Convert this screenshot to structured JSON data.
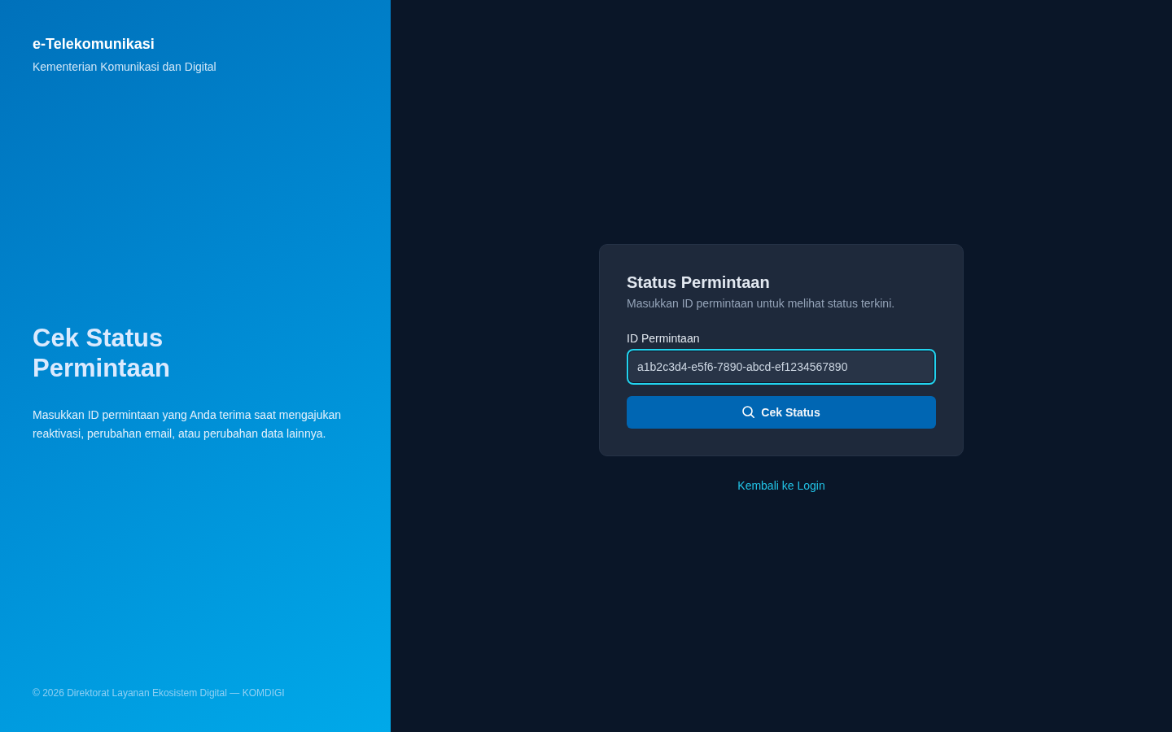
{
  "brand": {
    "title": "e-Telekomunikasi",
    "subtitle": "Kementerian Komunikasi dan Digital"
  },
  "hero": {
    "title": "Cek Status Permintaan",
    "description": "Masukkan ID permintaan yang Anda terima saat mengajukan reaktivasi, perubahan email, atau perubahan data lainnya."
  },
  "footer": "© 2026 Direktorat Layanan Ekosistem Digital — KOMDIGI",
  "card": {
    "title": "Status Permintaan",
    "subtitle": "Masukkan ID permintaan untuk melihat status terkini.",
    "field": {
      "label": "ID Permintaan",
      "value": "a1b2c3d4-e5f6-7890-abcd-ef1234567890",
      "focused": true
    },
    "button": {
      "label": "Cek Status"
    }
  },
  "back_link": "Kembali ke Login"
}
